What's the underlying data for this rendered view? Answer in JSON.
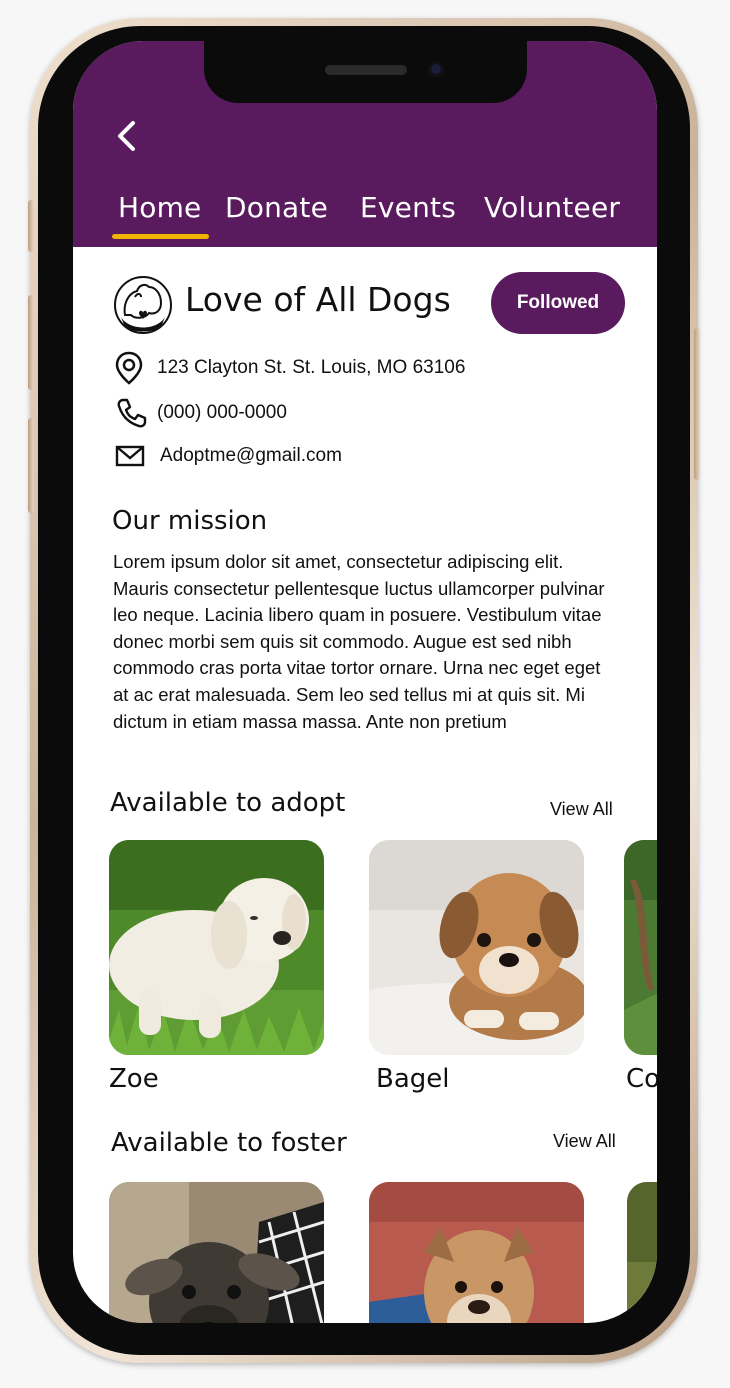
{
  "nav": {
    "back_icon": "chevron-left-icon",
    "tabs": [
      {
        "label": "Home",
        "active": true
      },
      {
        "label": "Donate",
        "active": false
      },
      {
        "label": "Events",
        "active": false
      },
      {
        "label": "Volunteer",
        "active": false
      }
    ]
  },
  "org": {
    "name": "Love of All Dogs",
    "follow_label": "Followed",
    "address": "123 Clayton St. St. Louis, MO 63106",
    "phone": "(000) 000-0000",
    "email": "Adoptme@gmail.com"
  },
  "mission": {
    "title": "Our mission",
    "text": "Lorem ipsum dolor sit amet, consectetur adipiscing elit. Mauris consectetur pellentesque luctus ullamcorper pulvinar leo neque. Lacinia libero quam in posuere. Vestibulum vitae donec morbi sem quis sit commodo. Augue est sed nibh commodo cras porta vitae tortor ornare. Urna nec eget eget at ac erat malesuada. Sem leo sed tellus mi at quis sit. Mi dictum in etiam massa massa. Ante non pretium"
  },
  "adopt": {
    "title": "Available to adopt",
    "view_all": "View All",
    "pets": [
      {
        "name": "Zoe"
      },
      {
        "name": "Bagel"
      },
      {
        "name": "Co"
      }
    ]
  },
  "foster": {
    "title": "Available to foster",
    "view_all": "View All"
  },
  "colors": {
    "brand_purple": "#5a1a5e",
    "tab_underline": "#f0b400"
  }
}
